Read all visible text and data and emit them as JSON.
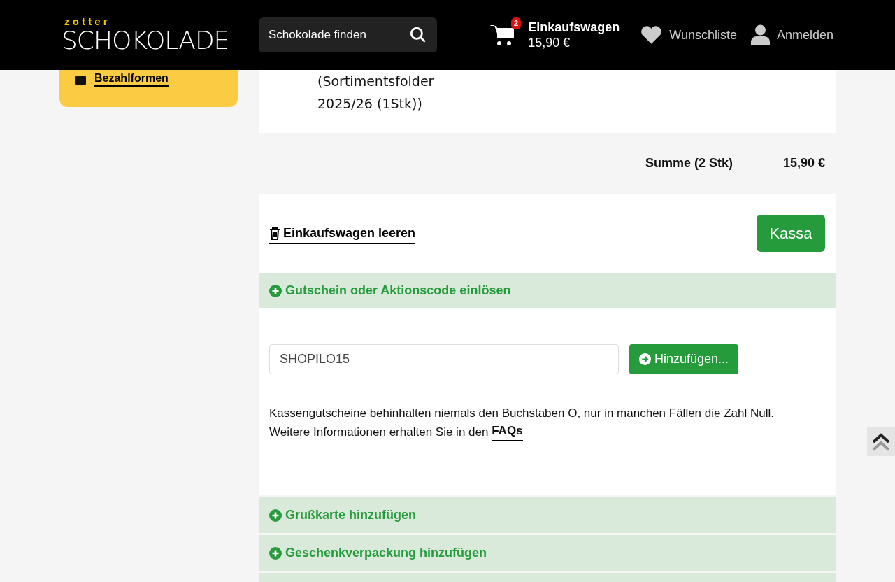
{
  "header": {
    "logo_top": "z o t t e r",
    "logo_main": "SCHOKOLADE",
    "search": {
      "placeholder": "Schokolade finden"
    },
    "cart": {
      "count": "2",
      "label": "Einkaufswagen",
      "total": "15,90 €"
    },
    "wishlist": "Wunschliste",
    "login": "Anmelden"
  },
  "sidebar": {
    "link": "Bezahlformen"
  },
  "product": {
    "lines": [
      "(Sortimentsfolder",
      "2025/26 (1Stk))"
    ]
  },
  "summary": {
    "label": "Summe (2 Stk)",
    "value": "15,90 €"
  },
  "actions": {
    "clear": "Einkaufswagen leeren",
    "checkout": "Kassa"
  },
  "accordions": [
    {
      "title": "Gutschein oder Aktionscode einlösen",
      "panel": {
        "code_value": "SHOPILO15",
        "add_button": "Hinzufügen...",
        "note": "Kassengutscheine behinhalten niemals den Buchstaben O, nur in manchen Fällen die Zahl Null.",
        "note2": "Weitere Informationen erhalten Sie in den ",
        "link": "FAQs"
      }
    },
    {
      "title": "Grußkarte hinzufügen"
    },
    {
      "title": "Geschenkverpackung hinzufügen"
    }
  ]
}
